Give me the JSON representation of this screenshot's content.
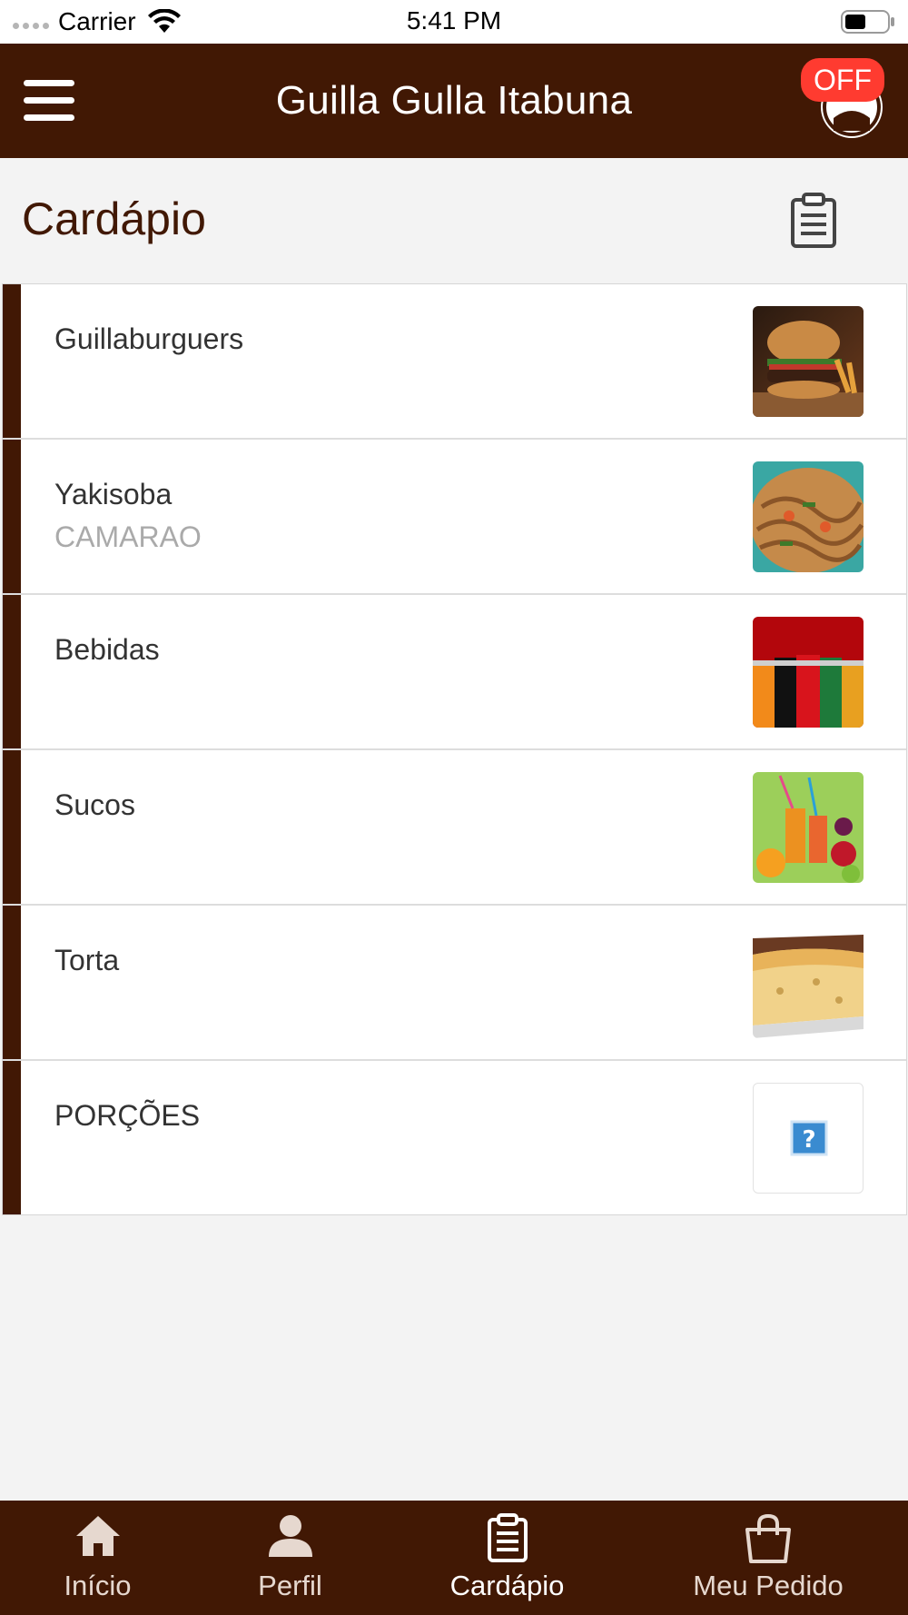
{
  "status_bar": {
    "carrier": "Carrier",
    "time": "5:41 PM"
  },
  "header": {
    "title": "Guilla Gulla Itabuna",
    "status_badge": "OFF",
    "colors": {
      "brand": "#411804",
      "badge": "#ff3b30"
    }
  },
  "page": {
    "title": "Cardápio",
    "order_icon": "clipboard-icon"
  },
  "categories": [
    {
      "name": "Guillaburguers",
      "subtitle": "",
      "image": "burger-photo"
    },
    {
      "name": "Yakisoba",
      "subtitle": "CAMARAO",
      "image": "noodles-photo"
    },
    {
      "name": "Bebidas",
      "subtitle": "",
      "image": "soda-cans-photo"
    },
    {
      "name": "Sucos",
      "subtitle": "",
      "image": "juices-photo"
    },
    {
      "name": "Torta",
      "subtitle": "",
      "image": "pie-slice-photo"
    },
    {
      "name": "PORÇÕES",
      "subtitle": "",
      "image": "missing-image-icon"
    }
  ],
  "tab_bar": {
    "tabs": [
      {
        "label": "Início",
        "icon": "home-icon",
        "active": false
      },
      {
        "label": "Perfil",
        "icon": "user-icon",
        "active": false
      },
      {
        "label": "Cardápio",
        "icon": "clipboard-icon",
        "active": true
      },
      {
        "label": "Meu Pedido",
        "icon": "shopping-bag-icon",
        "active": false
      }
    ]
  }
}
